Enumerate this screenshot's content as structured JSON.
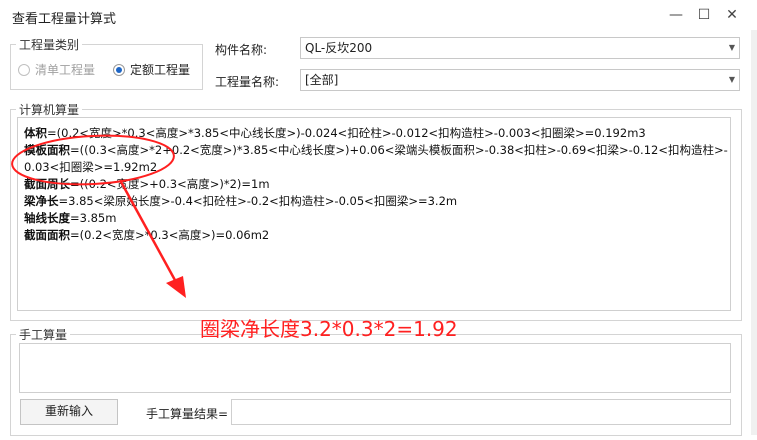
{
  "window": {
    "title": "查看工程量计算式",
    "minimize": "—",
    "maximize": "☐",
    "close": "✕"
  },
  "qty_type": {
    "legend": "工程量类别",
    "options": [
      {
        "label": "清单工程量",
        "selected": false,
        "disabled": true
      },
      {
        "label": "定额工程量",
        "selected": true,
        "disabled": false
      }
    ]
  },
  "component": {
    "label": "构件名称:",
    "value": "QL-反坎200"
  },
  "qty_name": {
    "label": "工程量名称:",
    "value": "[全部]"
  },
  "computer_calc": {
    "legend": "计算机算量",
    "lines": [
      {
        "name": "体积",
        "formula": "=(0.2<宽度>*0.3<高度>*3.85<中心线长度>)-0.024<扣砼柱>-0.012<扣构造柱>-0.003<扣圈梁>=0.192m3"
      },
      {
        "name": "模板面积",
        "formula": "=((0.3<高度>*2+0.2<宽度>)*3.85<中心线长度>)+0.06<梁端头模板面积>-0.38<扣柱>-0.69<扣梁>-0.12<扣构造柱>-"
      },
      {
        "name": "",
        "formula": "0.03<扣圈梁>=1.92m2"
      },
      {
        "name": "截面周长",
        "formula": "=((0.2<宽度>+0.3<高度>)*2)=1m"
      },
      {
        "name": "梁净长",
        "formula": "=3.85<梁原始长度>-0.4<扣砼柱>-0.2<扣构造柱>-0.05<扣圈梁>=3.2m"
      },
      {
        "name": "轴线长度",
        "formula": "=3.85m"
      },
      {
        "name": "截面面积",
        "formula": "=(0.2<宽度>*0.3<高度>)=0.06m2"
      }
    ]
  },
  "manual_calc": {
    "legend": "手工算量",
    "reenter_button": "重新输入",
    "result_label": "手工算量结果=",
    "result_value": ""
  },
  "annotation": {
    "text": "圈梁净长度3.2*0.3*2=1.92",
    "color": "#ff2020"
  }
}
